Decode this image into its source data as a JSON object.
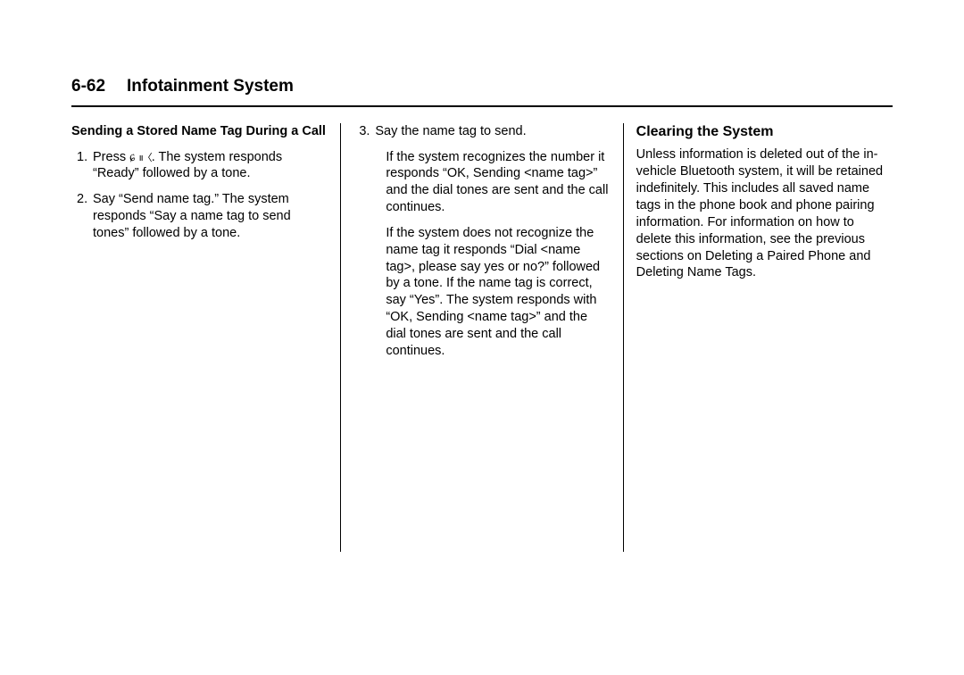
{
  "header": {
    "pageNumber": "6-62",
    "title": "Infotainment System"
  },
  "column1": {
    "subheading": "Sending a Stored Name Tag During a Call",
    "items": [
      {
        "num": "1.",
        "prefix": "Press ",
        "icons": true,
        "suffix": ". The system responds “Ready” followed by a tone."
      },
      {
        "num": "2.",
        "text": "Say “Send name tag.” The system responds “Say a name tag to send tones” followed by a tone."
      }
    ]
  },
  "column2": {
    "item3": {
      "num": "3.",
      "text": "Say the name tag to send."
    },
    "sub1": "If the system recognizes the number it responds “OK, Sending <name tag>” and the dial tones are sent and the call continues.",
    "sub2": "If the system does not recognize the name tag it responds “Dial <name tag>, please say yes or no?” followed by a tone. If the name tag is correct, say “Yes”. The system responds with “OK, Sending <name tag>” and the dial tones are sent and the call continues."
  },
  "column3": {
    "heading": "Clearing the System",
    "body": "Unless information is deleted out of the in-vehicle Bluetooth system, it will be retained indefinitely. This includes all saved name tags in the phone book and phone pairing information. For information on how to delete this information, see the previous sections on Deleting a Paired Phone and Deleting Name Tags."
  }
}
